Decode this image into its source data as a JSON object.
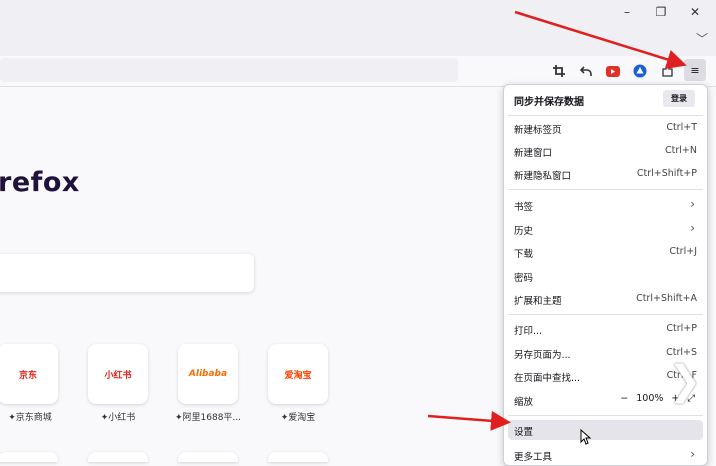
{
  "window": {
    "minimize_glyph": "–",
    "restore_glyph": "❐",
    "close_glyph": "✕",
    "tab_list_glyph": "﹀"
  },
  "toolbar": {
    "icons": [
      "crop-icon",
      "undo-icon",
      "video-icon",
      "account-triangle-icon",
      "extensions-icon",
      "hamburger-menu-icon"
    ],
    "menu_glyph": "≡"
  },
  "newtab": {
    "brand_text": "refox",
    "tiles": [
      {
        "logo": "京东",
        "label": "京东商城"
      },
      {
        "logo": "小红书",
        "label": "小红书"
      },
      {
        "logo": "Alibaba",
        "label": "阿里1688平..."
      },
      {
        "logo": "爱淘宝",
        "label": "爱淘宝"
      }
    ],
    "pin_glyph": "✦"
  },
  "app_menu": {
    "sync_title": "同步并保存数据",
    "signin_label": "登录",
    "groups": [
      [
        {
          "label": "新建标签页",
          "shortcut": "Ctrl+T"
        },
        {
          "label": "新建窗口",
          "shortcut": "Ctrl+N"
        },
        {
          "label": "新建隐私窗口",
          "shortcut": "Ctrl+Shift+P"
        }
      ],
      [
        {
          "label": "书签",
          "arrow": "›"
        },
        {
          "label": "历史",
          "arrow": "›"
        },
        {
          "label": "下载",
          "shortcut": "Ctrl+J"
        },
        {
          "label": "密码"
        },
        {
          "label": "扩展和主题",
          "shortcut": "Ctrl+Shift+A"
        }
      ],
      [
        {
          "label": "打印...",
          "shortcut": "Ctrl+P"
        },
        {
          "label": "另存页面为...",
          "shortcut": "Ctrl+S"
        },
        {
          "label": "在页面中查找...",
          "shortcut": "Ctrl+F"
        }
      ]
    ],
    "zoom": {
      "label": "缩放",
      "minus": "−",
      "value": "100%",
      "plus": "+",
      "fullscreen": "⤢"
    },
    "settings_label": "设置",
    "more_tools_label": "更多工具",
    "more_tools_arrow": "›"
  },
  "colors": {
    "accent_red": "#e02020",
    "brand_dark": "#20123a",
    "hover_bg": "#e4e4ea"
  }
}
